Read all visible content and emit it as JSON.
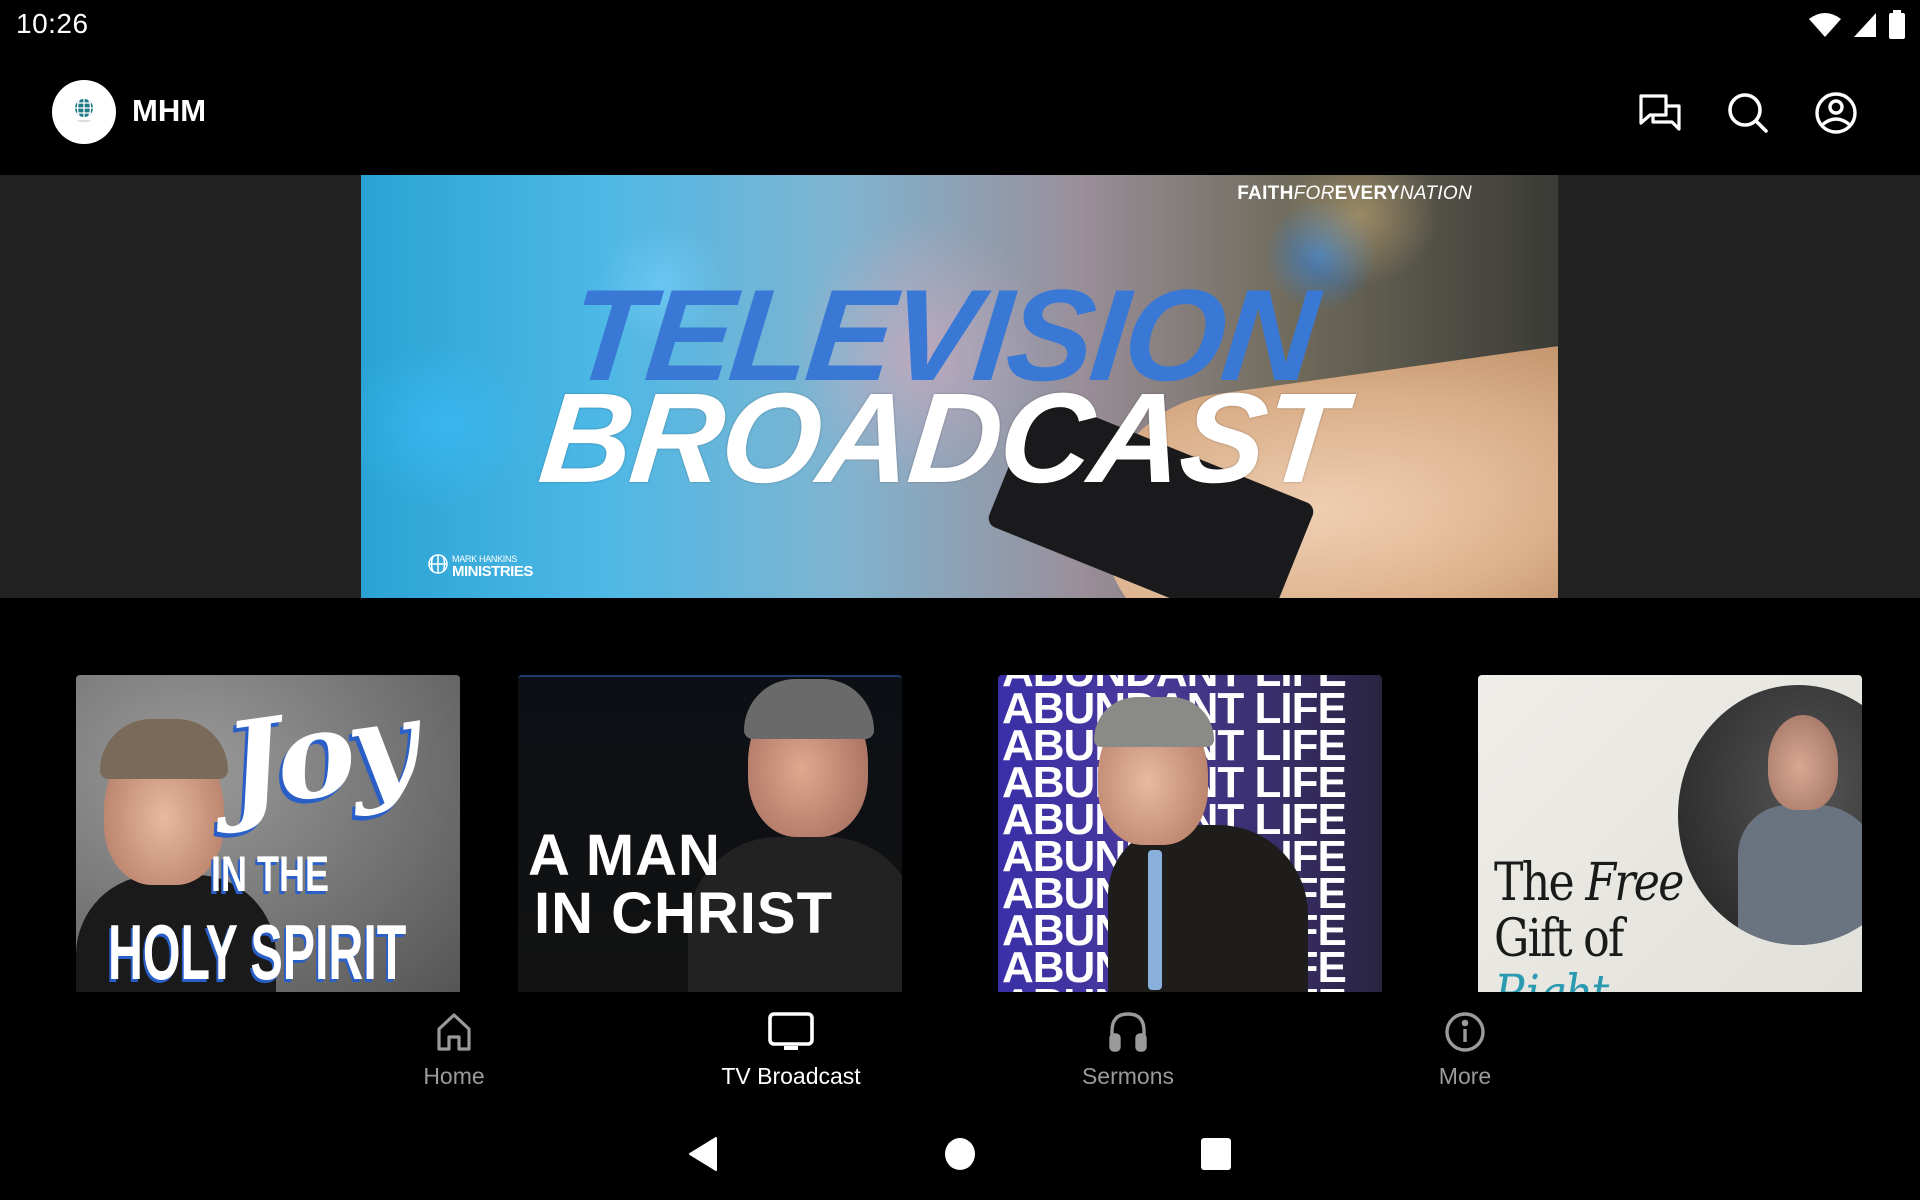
{
  "status_bar": {
    "time": "10:26",
    "icons": [
      "wifi-icon",
      "cellular-signal-icon",
      "battery-icon"
    ]
  },
  "app_bar": {
    "title": "MHM",
    "logo": "globe-logo",
    "actions": [
      {
        "name": "chat-icon",
        "label": "Messages"
      },
      {
        "name": "search-icon",
        "label": "Search"
      },
      {
        "name": "account-icon",
        "label": "Account"
      }
    ]
  },
  "hero": {
    "tagline_bold": "FAITH",
    "tagline_light_1": "FOR",
    "tagline_bold_2": "EVERY",
    "tagline_light_2": "NATION",
    "title_line_1": "TELEVISION",
    "title_line_2": "BROADCAST",
    "brand_small": "MARK HANKINS",
    "brand_big": "MINISTRIES",
    "colors": {
      "title_blue": "#3a78d6",
      "side_background": "#222222"
    }
  },
  "cards": [
    {
      "title_script": "Joy",
      "title_line_2": "IN THE",
      "title_line_3": "HOLY SPIRIT"
    },
    {
      "title_line_1": "A MAN",
      "title_line_2": "IN CHRIST"
    },
    {
      "repeated_text": "ABUNDANT LIFE"
    },
    {
      "title_word_1": "The",
      "title_word_2": "Free",
      "title_line_2": "Gift of",
      "title_line_3": "Right"
    }
  ],
  "bottom_nav": {
    "items": [
      {
        "label": "Home",
        "icon": "home-icon",
        "active": false
      },
      {
        "label": "TV Broadcast",
        "icon": "tv-icon",
        "active": true
      },
      {
        "label": "Sermons",
        "icon": "headphones-icon",
        "active": false
      },
      {
        "label": "More",
        "icon": "info-icon",
        "active": false
      }
    ],
    "colors": {
      "active": "#ffffff",
      "inactive": "#9a9a9a"
    }
  },
  "system_nav": {
    "buttons": [
      "back-icon",
      "home-circle-icon",
      "recents-icon"
    ]
  }
}
